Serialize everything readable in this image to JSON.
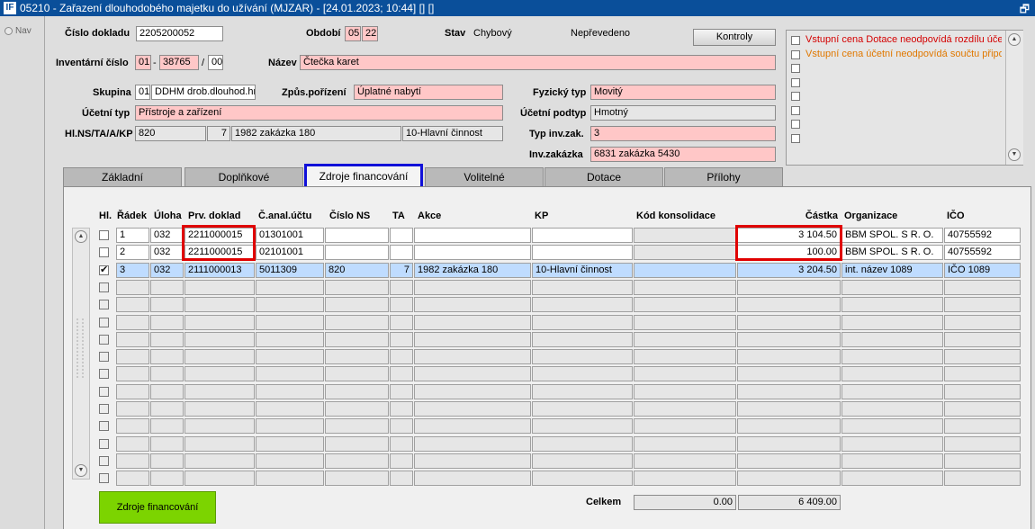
{
  "window": {
    "title": "05210 - Zařazení dlouhodobého majetku do užívání (MJZAR) - [24.01.2023; 10:44] [] []",
    "logo": "IF",
    "restore_glyph": "🗗"
  },
  "nav": {
    "label": "Nav"
  },
  "header": {
    "cislo_dokladu": {
      "label": "Číslo dokladu",
      "value": "2205200052"
    },
    "obdobi": {
      "label": "Období",
      "month": "05",
      "year": "22"
    },
    "stav": {
      "label": "Stav",
      "value": "Chybový",
      "value2": "Nepřevedeno"
    },
    "kontroly_button": "Kontroly",
    "inventarni_cislo": {
      "label": "Inventární číslo",
      "part1": "01",
      "sep1": "-",
      "part2": "38765",
      "sep2": "/",
      "part3": "00"
    },
    "nazev": {
      "label": "Název",
      "value": "Čtečka karet"
    },
    "skupina": {
      "label": "Skupina",
      "code": "01",
      "value": "DDHM drob.dlouhod.hm"
    },
    "zpusob_porizeni": {
      "label": "Způs.pořízení",
      "value": "Úplatné nabytí"
    },
    "fyzicky_typ": {
      "label": "Fyzický typ",
      "value": "Movitý"
    },
    "ucetni_typ": {
      "label": "Účetní typ",
      "value": "Přístroje a zařízení"
    },
    "ucetni_podtyp": {
      "label": "Účetní podtyp",
      "value": "Hmotný"
    },
    "hl_ns": {
      "label": "Hl.NS/TA/A/KP",
      "ns": "820",
      "ta": "7",
      "akce": "1982 zakázka 180",
      "kp": "10-Hlavní činnost"
    },
    "typ_inv_zak": {
      "label": "Typ inv.zak.",
      "value": "3"
    },
    "inv_zakazka": {
      "label": "Inv.zakázka",
      "value": "6831 zakázka 5430"
    }
  },
  "messages": [
    {
      "text": "Vstupní cena Dotace neodpovídá rozdílu účet",
      "color": "#d40000"
    },
    {
      "text": "Vstupní cena účetní neodpovídá součtu připo",
      "color": "#e07800"
    }
  ],
  "tabs": [
    {
      "label": "Základní",
      "active": false
    },
    {
      "label": "Doplňkové",
      "active": false
    },
    {
      "label": "Zdroje financování",
      "active": true
    },
    {
      "label": "Volitelné",
      "active": false
    },
    {
      "label": "Dotace",
      "active": false
    },
    {
      "label": "Přílohy",
      "active": false
    }
  ],
  "grid": {
    "columns": [
      "Hl.",
      "Řádek",
      "Úloha",
      "Prv. doklad",
      "Č.anal.účtu",
      "Číslo NS",
      "TA",
      "Akce",
      "KP",
      "Kód konsolidace",
      "Částka",
      "Organizace",
      "IČO"
    ],
    "rows": [
      {
        "hl": false,
        "radek": "1",
        "uloha": "032",
        "prv_doklad": "2211000015",
        "anal": "01301001",
        "ns": "",
        "ta": "",
        "akce": "",
        "kp": "",
        "kod": "",
        "castka": "3 104.50",
        "org": "BBM SPOL. S R. O.",
        "ico": "40755592",
        "selected": false
      },
      {
        "hl": false,
        "radek": "2",
        "uloha": "032",
        "prv_doklad": "2211000015",
        "anal": "02101001",
        "ns": "",
        "ta": "",
        "akce": "",
        "kp": "",
        "kod": "",
        "castka": "100.00",
        "org": "BBM SPOL. S R. O.",
        "ico": "40755592",
        "selected": false
      },
      {
        "hl": true,
        "radek": "3",
        "uloha": "032",
        "prv_doklad": "2111000013",
        "anal": "5011309",
        "ns": "820",
        "ta": "7",
        "akce": "1982 zakázka 180",
        "kp": "10-Hlavní činnost",
        "kod": "",
        "castka": "3 204.50",
        "org": "int. název 1089",
        "ico": "IČO 1089",
        "selected": true
      }
    ],
    "empty_rows": 12
  },
  "footer": {
    "zdroje_button": "Zdroje financování",
    "celkem_label": "Celkem",
    "celkem_1": "0.00",
    "celkem_2": "6 409.00"
  }
}
